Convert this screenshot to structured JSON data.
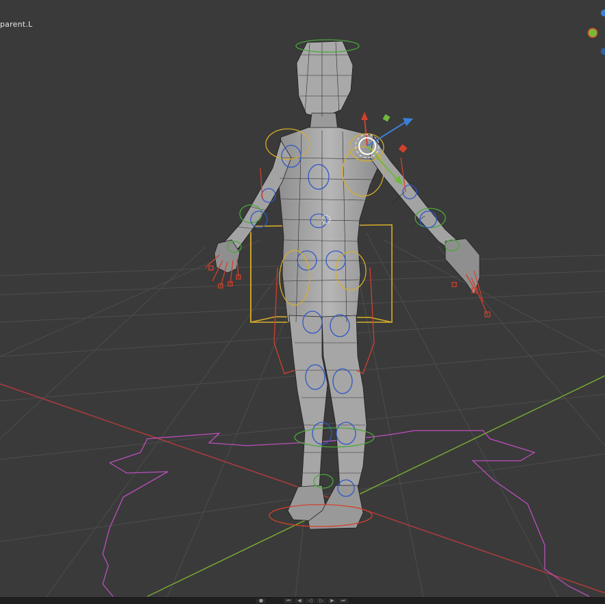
{
  "viewport": {
    "active_object_label": "parent.L",
    "background_color": "#3a3a3a"
  },
  "colors": {
    "grid": "#4c4c4c",
    "x_axis": "#b33a3a",
    "y_axis": "#7aa834",
    "mesh_fill": "#9d9d9d",
    "mesh_wire": "#1c1c1c",
    "bone_blue": "#2f57c7",
    "bone_yellow": "#d9b12a",
    "bone_red": "#d2402c",
    "bone_green": "#4aa83a",
    "root_control": "#c04cc0"
  },
  "gizmo": {
    "axes": [
      "x-axis-dot",
      "y-axis-dot",
      "z-axis-dot"
    ]
  },
  "playback": {
    "icons": [
      "jump-start-icon",
      "step-back-icon",
      "play-reverse-icon",
      "play-icon",
      "step-forward-icon",
      "jump-end-icon"
    ]
  }
}
